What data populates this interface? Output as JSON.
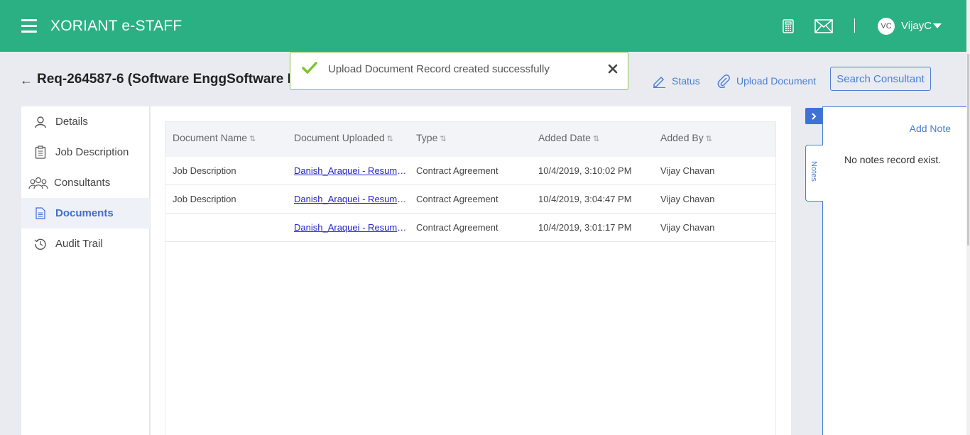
{
  "header": {
    "brand": "XORIANT e-STAFF",
    "user_initials": "VC",
    "user_name": "VijayC",
    "separator": "|"
  },
  "page": {
    "title": "Req-264587-6 (Software EnggSoftware E",
    "back_arrow": "←"
  },
  "actions": {
    "status_label": "Status",
    "upload_label": "Upload Document",
    "search_label": "Search Consultant"
  },
  "toast": {
    "message": "Upload Document Record created successfully"
  },
  "sidebar": {
    "items": [
      {
        "label": "Details",
        "icon": "user-icon"
      },
      {
        "label": "Job Description",
        "icon": "clipboard-icon"
      },
      {
        "label": "Consultants",
        "icon": "users-icon"
      },
      {
        "label": "Documents",
        "icon": "document-icon",
        "active": true
      },
      {
        "label": "Audit Trail",
        "icon": "history-icon"
      }
    ]
  },
  "table": {
    "columns": [
      "Document Name",
      "Document Uploaded",
      "Type",
      "Added Date",
      "Added By"
    ],
    "sort_icon": "⇅",
    "rows": [
      {
        "name": "Job Description",
        "file": "Danish_Araquei - Resume...",
        "type": "Contract Agreement",
        "date": "10/4/2019, 3:10:02 PM",
        "by": "Vijay Chavan"
      },
      {
        "name": "Job Description",
        "file": "Danish_Araquei - Resume...",
        "type": "Contract Agreement",
        "date": "10/4/2019, 3:04:47 PM",
        "by": "Vijay Chavan"
      },
      {
        "name": "",
        "file": "Danish_Araquei - Resume...",
        "type": "Contract Agreement",
        "date": "10/4/2019, 3:01:17 PM",
        "by": "Vijay Chavan"
      }
    ]
  },
  "notes": {
    "tab_label": "Notes",
    "add_label": "Add Note",
    "empty_text": "No notes record exist."
  },
  "colors": {
    "header_green": "#2bb084",
    "accent_blue": "#4a7fd4",
    "toast_border": "#8bc34a"
  }
}
